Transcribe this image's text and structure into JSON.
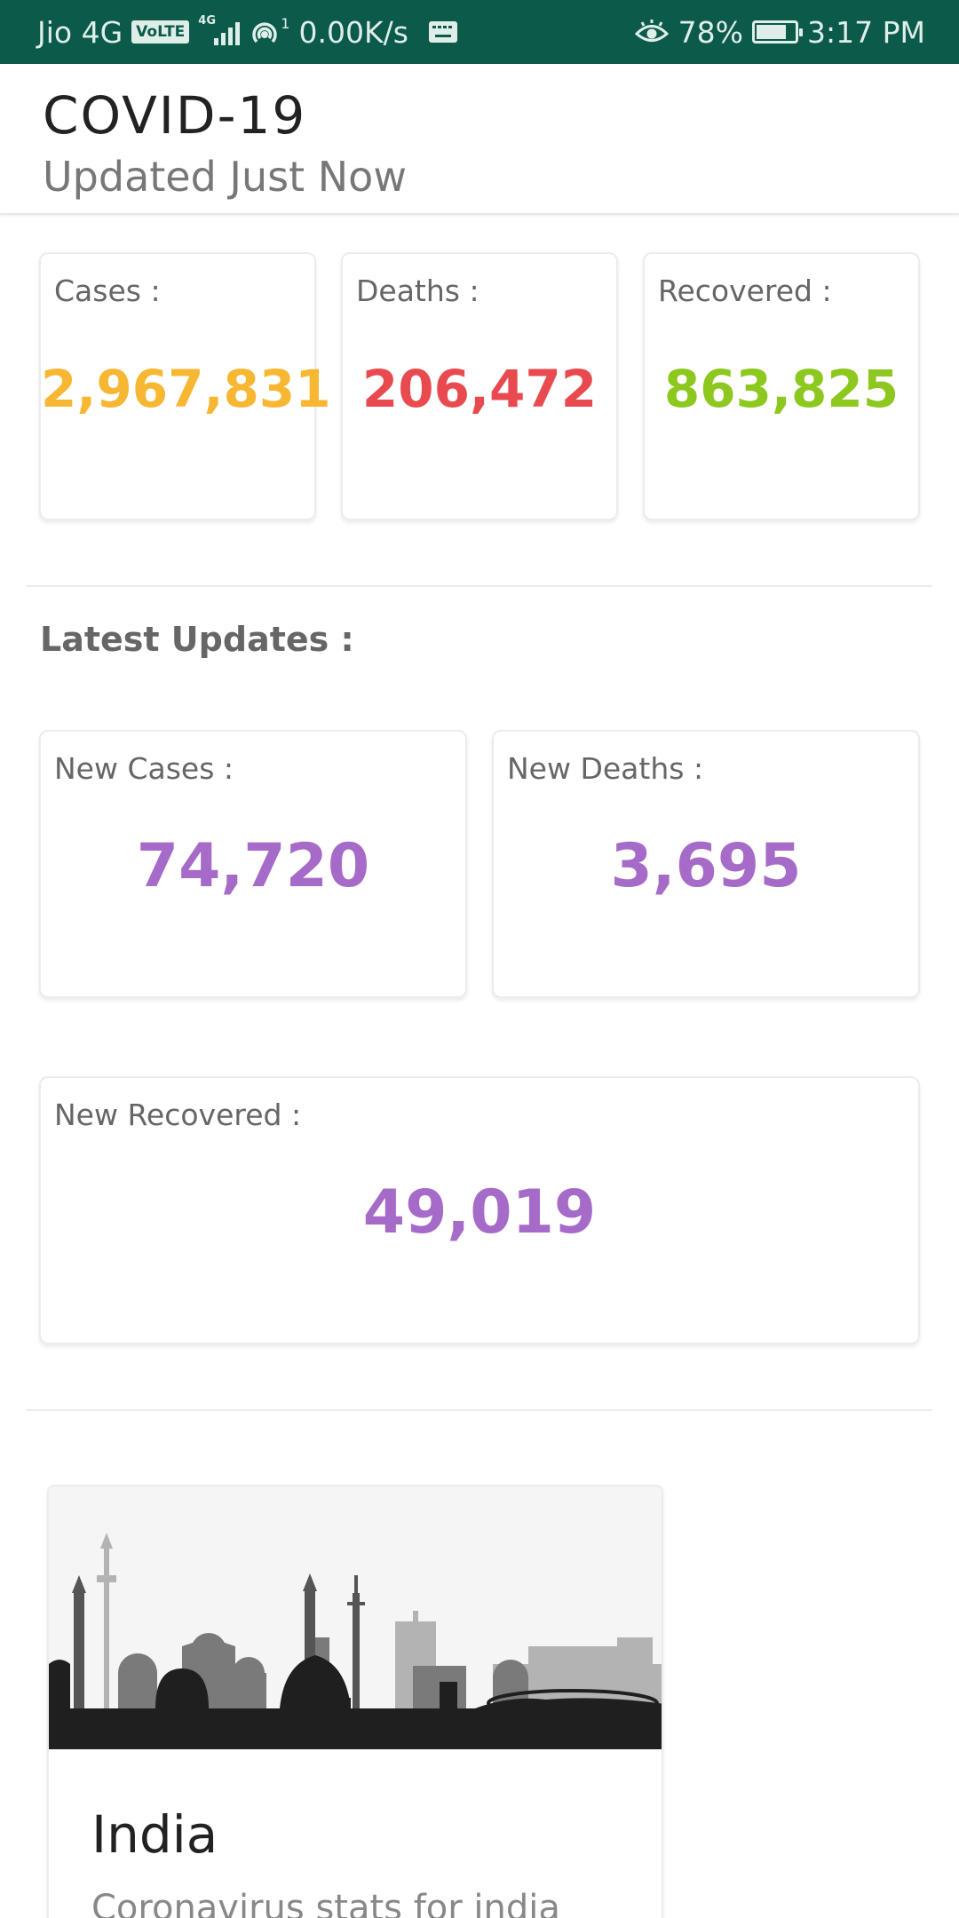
{
  "status_bar": {
    "carrier": "Jio 4G",
    "volte": "VoLTE",
    "network_tag": "4G",
    "hotspot_count": "1",
    "speed": "0.00K/s",
    "battery": "78%",
    "battery_level": 0.78,
    "time": "3:17 PM"
  },
  "header": {
    "title": "COVID-19",
    "subtitle": "Updated Just Now"
  },
  "totals": {
    "cases_label": "Cases :",
    "cases_value": "2,967,831",
    "deaths_label": "Deaths :",
    "deaths_value": "206,472",
    "recovered_label": "Recovered :",
    "recovered_value": "863,825"
  },
  "latest": {
    "title": "Latest Updates :",
    "new_cases_label": "New Cases :",
    "new_cases_value": "74,720",
    "new_deaths_label": "New Deaths :",
    "new_deaths_value": "3,695",
    "new_recovered_label": "New Recovered :",
    "new_recovered_value": "49,019"
  },
  "country_card": {
    "name": "India",
    "description": "Coronavirus stats for india"
  },
  "colors": {
    "cases": "#f7b733",
    "deaths": "#e84a4f",
    "recovered": "#8cc81e",
    "latest": "#a66bc8",
    "status_bar": "#0b5a4a"
  }
}
